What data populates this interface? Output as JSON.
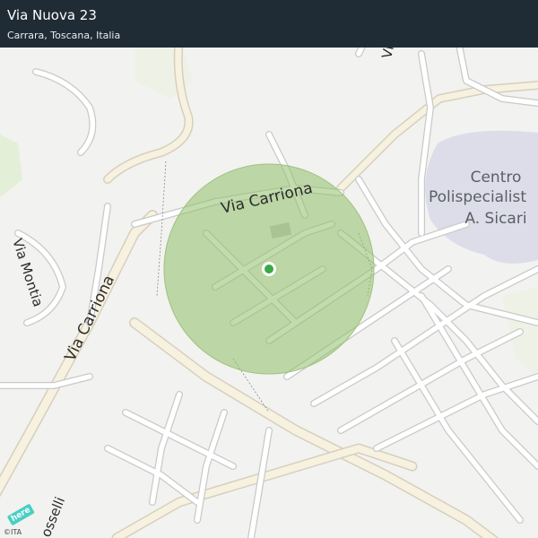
{
  "header": {
    "title": "Via Nuova 23",
    "subtitle": "Carrara, Toscana, Italia"
  },
  "map": {
    "street_labels": {
      "via_carriona_top": "Via  Carriona",
      "via_carriona_left": "Via  Carriona",
      "via_montia": "Via  Montia",
      "via_di": "Via  di",
      "via_bottom_partial": "osselli"
    },
    "poi": {
      "line1": "Centro",
      "line2": "Polispecialist",
      "line3": "A. Sicari"
    },
    "colors": {
      "accuracy_circle": "#8fbf6a",
      "location_dot": "#3aa846",
      "header_bg": "#1f2b35",
      "poi_area": "#dcdde8"
    }
  },
  "footer": {
    "brand_logo": "here",
    "copyright": "©ITA"
  }
}
